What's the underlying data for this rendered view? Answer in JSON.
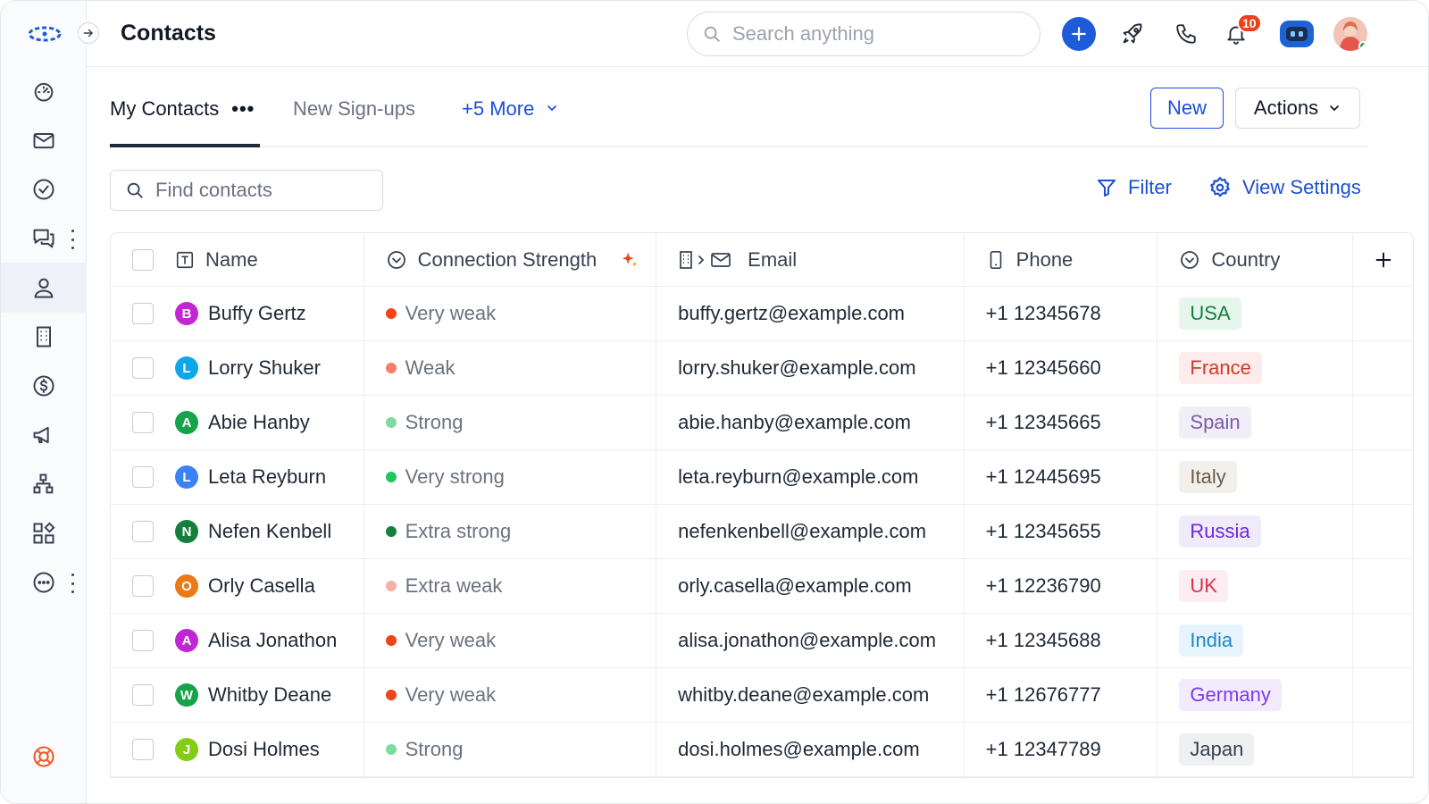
{
  "header": {
    "title": "Contacts",
    "search_placeholder": "Search anything",
    "notifications_count": "10"
  },
  "tabs": {
    "my_contacts": "My Contacts",
    "new_signups": "New Sign-ups",
    "more": "+5 More"
  },
  "buttons": {
    "new": "New",
    "actions": "Actions"
  },
  "toolbar": {
    "find_placeholder": "Find contacts",
    "filter": "Filter",
    "view_settings": "View Settings"
  },
  "columns": {
    "name": "Name",
    "connection": "Connection Strength",
    "email": "Email",
    "phone": "Phone",
    "country": "Country"
  },
  "rows": [
    {
      "initial": "B",
      "avatar_color": "#c026d3",
      "name": "Buffy Gertz",
      "strength": "Very weak",
      "dot": "#f0441b",
      "email": "buffy.gertz@example.com",
      "phone": "+1 12345678",
      "country": "USA",
      "chip_bg": "#e7f6ec",
      "chip_fg": "#15803d"
    },
    {
      "initial": "L",
      "avatar_color": "#0ea5e9",
      "name": "Lorry Shuker",
      "strength": "Weak",
      "dot": "#f87e6a",
      "email": "lorry.shuker@example.com",
      "phone": "+1 12345660",
      "country": "France",
      "chip_bg": "#fdeceb",
      "chip_fg": "#d03a2b"
    },
    {
      "initial": "A",
      "avatar_color": "#16a34a",
      "name": "Abie Hanby",
      "strength": "Strong",
      "dot": "#7ddba0",
      "email": "abie.hanby@example.com",
      "phone": "+1 12345665",
      "country": "Spain",
      "chip_bg": "#f2eef8",
      "chip_fg": "#7c5aa8"
    },
    {
      "initial": "L",
      "avatar_color": "#3b82f6",
      "name": "Leta Reyburn",
      "strength": "Very strong",
      "dot": "#22c55e",
      "email": "leta.reyburn@example.com",
      "phone": "+1 12445695",
      "country": "Italy",
      "chip_bg": "#f3f0ec",
      "chip_fg": "#6b5a48"
    },
    {
      "initial": "N",
      "avatar_color": "#15803d",
      "name": "Nefen Kenbell",
      "strength": "Extra strong",
      "dot": "#15803d",
      "email": "nefenkenbell@example.com",
      "phone": "+1 12345655",
      "country": "Russia",
      "chip_bg": "#f0ebfb",
      "chip_fg": "#6d28d9"
    },
    {
      "initial": "O",
      "avatar_color": "#ea7a16",
      "name": "Orly Casella",
      "strength": "Extra weak",
      "dot": "#f7b0a6",
      "email": "orly.casella@example.com",
      "phone": "+1 12236790",
      "country": "UK",
      "chip_bg": "#fdecf0",
      "chip_fg": "#d9304f"
    },
    {
      "initial": "A",
      "avatar_color": "#c026d3",
      "name": "Alisa Jonathon",
      "strength": "Very weak",
      "dot": "#f0441b",
      "email": "alisa.jonathon@example.com",
      "phone": "+1 12345688",
      "country": "India",
      "chip_bg": "#e7f4fb",
      "chip_fg": "#1a8ac2"
    },
    {
      "initial": "W",
      "avatar_color": "#16a34a",
      "name": "Whitby Deane",
      "strength": "Very weak",
      "dot": "#f0441b",
      "email": "whitby.deane@example.com",
      "phone": "+1 12676777",
      "country": "Germany",
      "chip_bg": "#f2ebfd",
      "chip_fg": "#7c3aed"
    },
    {
      "initial": "J",
      "avatar_color": "#84cc16",
      "name": "Dosi Holmes",
      "strength": "Strong",
      "dot": "#7ddba0",
      "email": "dosi.holmes@example.com",
      "phone": "+1 12347789",
      "country": "Japan",
      "chip_bg": "#eef0f2",
      "chip_fg": "#374151"
    }
  ]
}
